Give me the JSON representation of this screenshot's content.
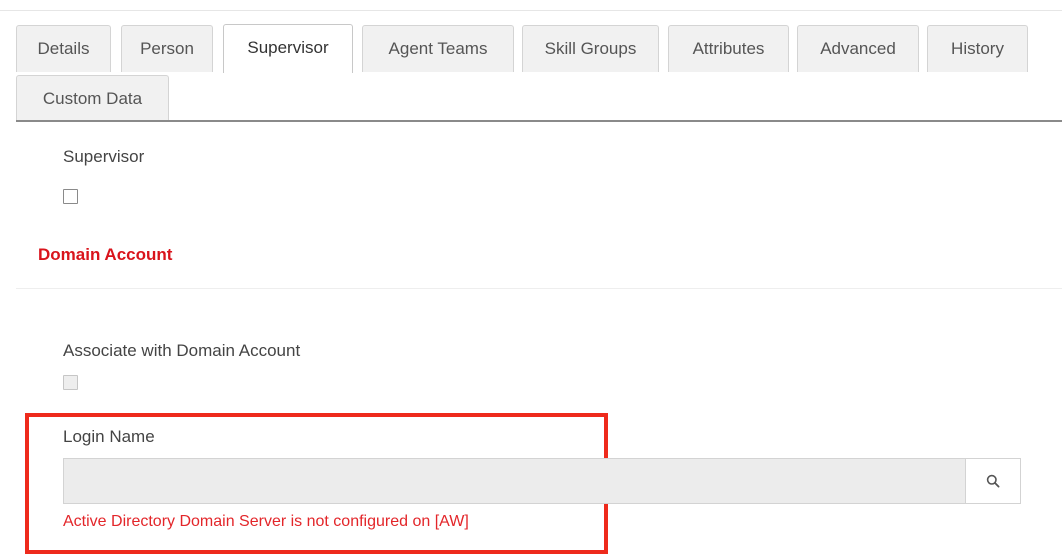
{
  "tabs": [
    {
      "label": "Details",
      "active": false
    },
    {
      "label": "Person",
      "active": false
    },
    {
      "label": "Supervisor",
      "active": true
    },
    {
      "label": "Agent Teams",
      "active": false
    },
    {
      "label": "Skill Groups",
      "active": false
    },
    {
      "label": "Attributes",
      "active": false
    },
    {
      "label": "Advanced",
      "active": false
    },
    {
      "label": "History",
      "active": false
    },
    {
      "label": "Custom Data",
      "active": false
    }
  ],
  "supervisor": {
    "label": "Supervisor",
    "checked": false
  },
  "domain_account": {
    "heading": "Domain Account",
    "heading_color": "#d9141c",
    "associate_label": "Associate with Domain Account",
    "associate_checked": false,
    "associate_disabled": true,
    "login_name_label": "Login Name",
    "login_name_value": "",
    "search_icon": "search-icon",
    "error_message": "Active Directory Domain Server is not configured on [AW]",
    "error_color": "#e3262a"
  },
  "highlight_color": "#ee2a1c"
}
